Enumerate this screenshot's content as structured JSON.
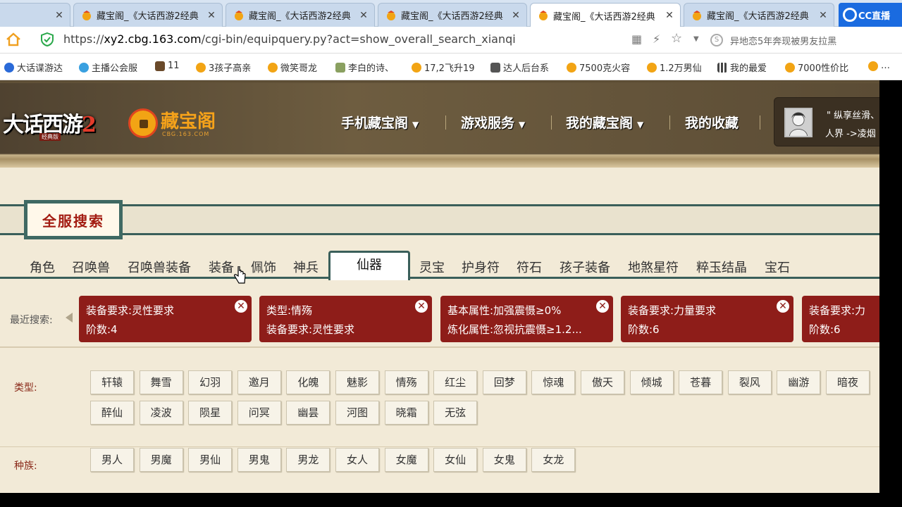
{
  "browser": {
    "tabs": [
      {
        "title": "",
        "active": false
      },
      {
        "title": "藏宝阁_《大话西游2经典",
        "active": false
      },
      {
        "title": "藏宝阁_《大话西游2经典",
        "active": false
      },
      {
        "title": "藏宝阁_《大话西游2经典",
        "active": false
      },
      {
        "title": "藏宝阁_《大话西游2经典",
        "active": true
      },
      {
        "title": "藏宝阁_《大话西游2经典",
        "active": false
      }
    ],
    "close_glyph": "✕",
    "cc_label": "CC直播",
    "url_prefix": "https://",
    "url_host": "xy2.cbg.163.com",
    "url_path": "/cgi-bin/equipquery.py?act=show_overall_search_xianqi",
    "side_search_text": "异地恋5年奔现被男友拉黑",
    "bookmarks": [
      "大话谍游达",
      "主播公会服",
      "11",
      "3孩子高亲",
      "微笑哥龙",
      "李白的诗、",
      "17,2飞升19",
      "达人后台系",
      "7500克火容",
      "1.2万男仙",
      "我的最爱",
      "7000性价比",
      "…"
    ]
  },
  "site": {
    "logo_text": "大话西游",
    "logo_num": "2",
    "logo_sub": "经典版",
    "cbg_name": "藏宝阁",
    "cbg_sub": "CBG.163.COM",
    "nav": [
      {
        "label": "手机藏宝阁",
        "dropdown": true
      },
      {
        "label": "游戏服务",
        "dropdown": true
      },
      {
        "label": "我的藏宝阁",
        "dropdown": true
      },
      {
        "label": "我的收藏",
        "dropdown": false
      }
    ],
    "caret": "▼",
    "user_line1": "\" 纵享丝滑、",
    "user_line2": "人界 ->凌烟"
  },
  "search": {
    "title": "全服搜索",
    "categories": [
      "角色",
      "召唤兽",
      "召唤兽装备",
      "装备",
      "佩饰",
      "神兵",
      "仙器",
      "灵宝",
      "护身符",
      "符石",
      "孩子装备",
      "地煞星符",
      "粹玉结晶",
      "宝石"
    ],
    "active_category": "仙器",
    "recent_label": "最近搜索:",
    "recent": [
      {
        "line1": "装备要求:灵性要求",
        "line2": "阶数:4"
      },
      {
        "line1": "类型:情殇",
        "line2": "装备要求:灵性要求"
      },
      {
        "line1": "基本属性:加强震慑≥0%",
        "line2": "炼化属性:忽视抗震慑≥1.2..."
      },
      {
        "line1": "装备要求:力量要求",
        "line2": "阶数:6"
      },
      {
        "line1": "装备要求:力",
        "line2": "阶数:6"
      }
    ],
    "close_glyph": "✕",
    "type_label": "类型:",
    "types": [
      "轩辕",
      "舞雪",
      "幻羽",
      "邀月",
      "化魄",
      "魅影",
      "情殇",
      "红尘",
      "回梦",
      "惊魂",
      "傲天",
      "倾城",
      "苍暮",
      "裂风",
      "幽游",
      "暗夜",
      "醉仙",
      "凌波",
      "陨星",
      "问冥",
      "幽昙",
      "河图",
      "晓霜",
      "无弦"
    ],
    "race_label": "种族:",
    "races": [
      "男人",
      "男魔",
      "男仙",
      "男鬼",
      "男龙",
      "女人",
      "女魔",
      "女仙",
      "女鬼",
      "女龙"
    ]
  }
}
